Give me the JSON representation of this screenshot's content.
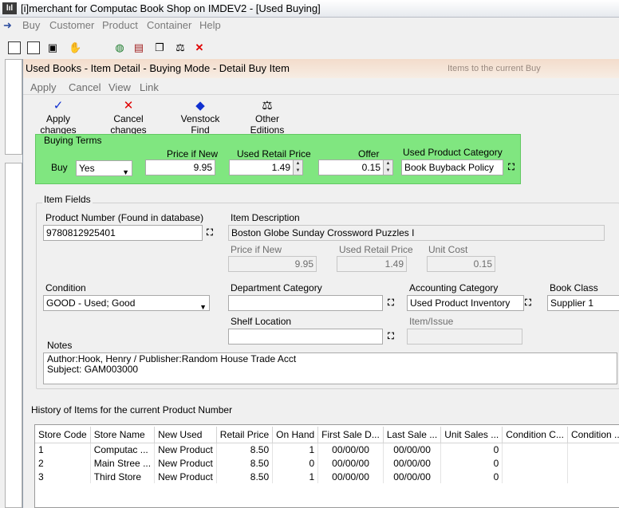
{
  "outer": {
    "title": "[i]merchant for Computac Book Shop on IMDEV2 - [Used Buying]",
    "menu": [
      "Buy",
      "Customer",
      "Product",
      "Container",
      "Help"
    ]
  },
  "child": {
    "title": "Used Books - Item Detail  - Buying Mode  - Detail Buy Item",
    "menu": [
      "Apply",
      "Cancel",
      "View",
      "Link"
    ],
    "toolbar": {
      "apply": "Apply changes",
      "cancel": "Cancel changes",
      "venstock": "Venstock Find",
      "editions": "Other Editions"
    }
  },
  "buying_terms": {
    "group_label": "Buying Terms",
    "buy_label": "Buy",
    "buy_value": "Yes",
    "price_if_new_label": "Price if New",
    "price_if_new": "9.95",
    "used_retail_label": "Used Retail Price",
    "used_retail": "1.49",
    "offer_label": "Offer",
    "offer": "0.15",
    "category_label": "Used Product Category",
    "category": "Book Buyback Policy"
  },
  "item_fields": {
    "group_label": "Item Fields",
    "product_number_label": "Product Number (Found in database)",
    "product_number": "9780812925401",
    "description_label": "Item Description",
    "description": "Boston Globe Sunday Crossword Puzzles I",
    "price_if_new_label": "Price if New",
    "price_if_new": "9.95",
    "used_retail_label": "Used Retail Price",
    "used_retail": "1.49",
    "unit_cost_label": "Unit Cost",
    "unit_cost": "0.15",
    "condition_label": "Condition",
    "condition": "GOOD - Used; Good",
    "department_label": "Department Category",
    "department": "",
    "accounting_label": "Accounting Category",
    "accounting": "Used Product Inventory",
    "book_class_label": "Book Class",
    "book_class": "Supplier 1",
    "shelf_label": "Shelf Location",
    "shelf": "",
    "item_issue_label": "Item/Issue",
    "item_issue": "",
    "notes_label": "Notes",
    "notes_line1": "Author:Hook, Henry / Publisher:Random House Trade Acct",
    "notes_line2": "Subject:  GAM003000"
  },
  "history": {
    "label": "History of Items for the current Product Number",
    "columns": [
      "Store Code",
      "Store Name",
      "New Used",
      "Retail Price",
      "On Hand",
      "First Sale D...",
      "Last Sale ...",
      "Unit Sales ...",
      "Condition C...",
      "Condition ..."
    ],
    "rows": [
      [
        "1",
        "Computac ...",
        "New Product",
        "8.50",
        "1",
        "00/00/00",
        "00/00/00",
        "0",
        "",
        ""
      ],
      [
        "2",
        "Main Stree ...",
        "New Product",
        "8.50",
        "0",
        "00/00/00",
        "00/00/00",
        "0",
        "",
        ""
      ],
      [
        "3",
        "Third Store",
        "New Product",
        "8.50",
        "1",
        "00/00/00",
        "00/00/00",
        "0",
        "",
        ""
      ]
    ]
  },
  "background_fragments": {
    "hint1": "Items to the current Buy"
  }
}
